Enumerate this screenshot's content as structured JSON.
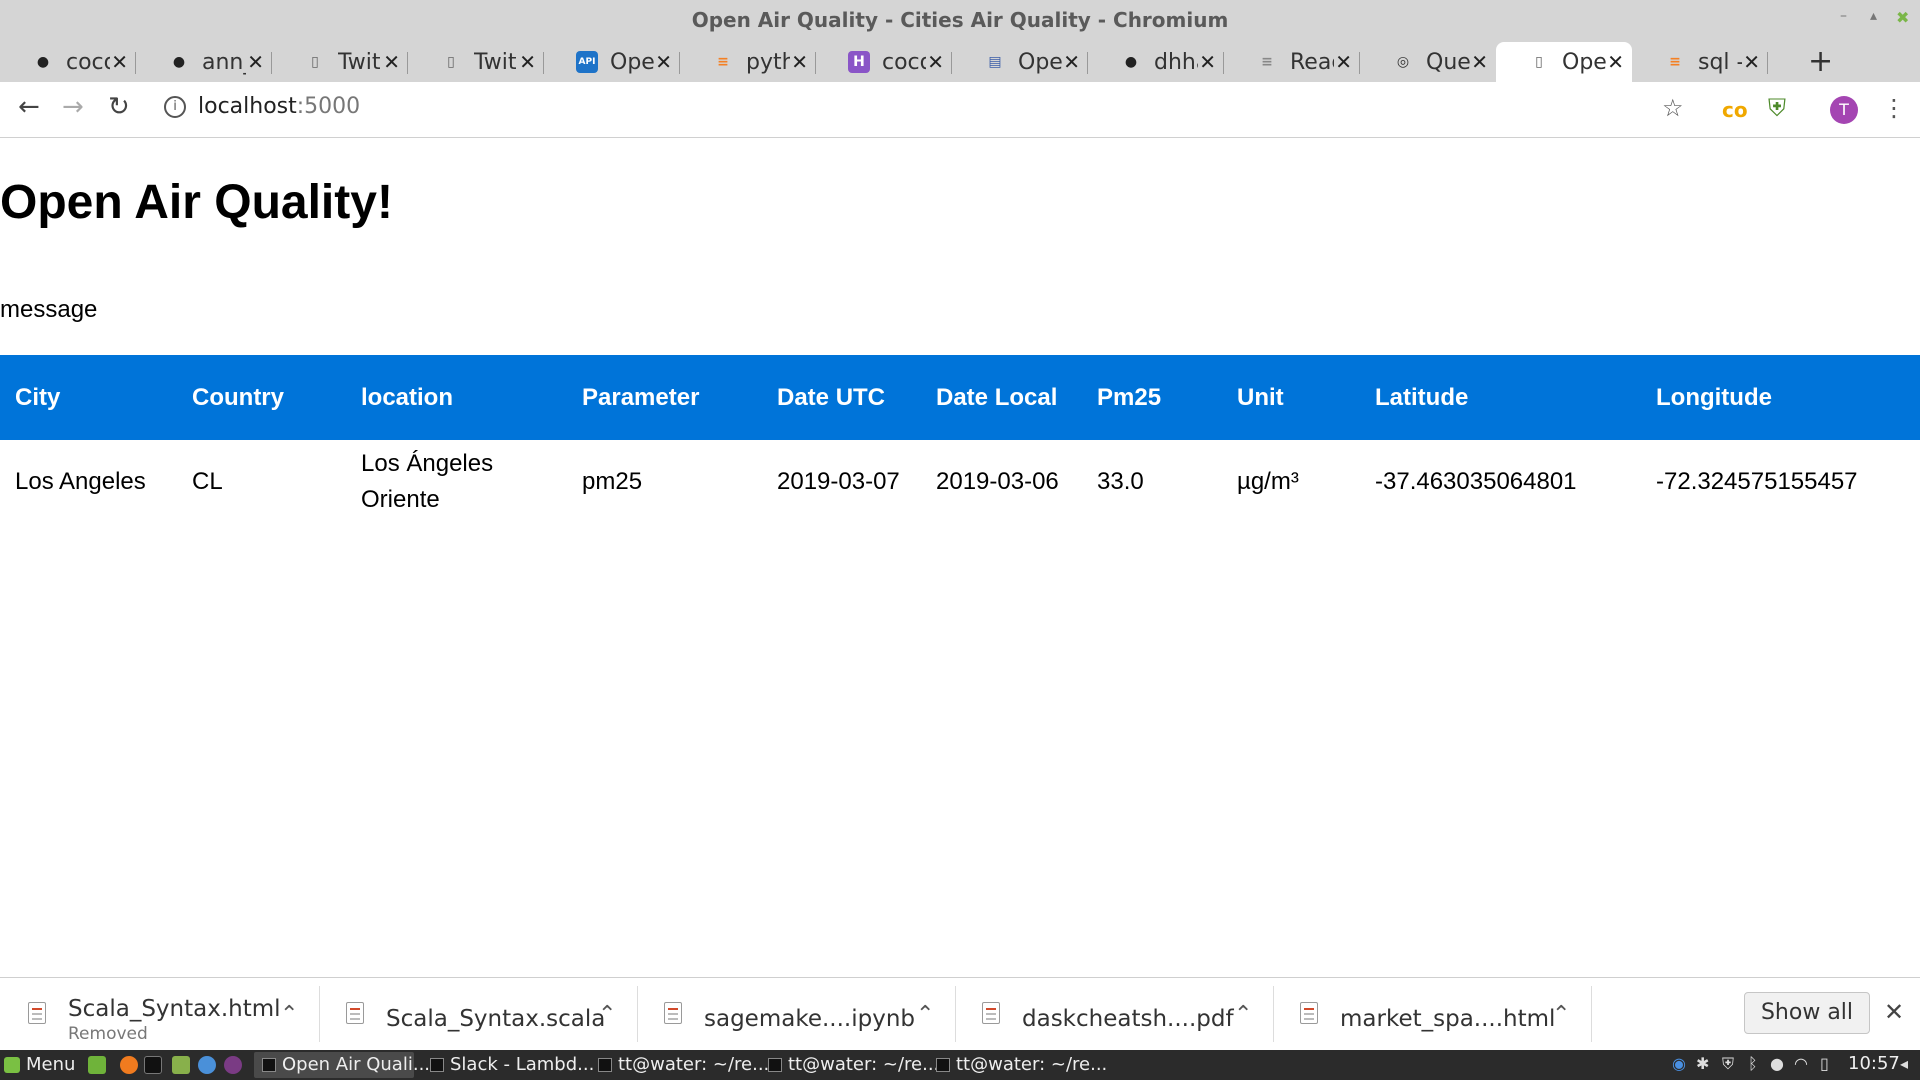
{
  "window": {
    "title": "Open Air Quality - Cities Air Quality - Chromium"
  },
  "tabs": [
    {
      "label": "coco",
      "icon": "github-icon"
    },
    {
      "label": "ann_",
      "icon": "github-icon"
    },
    {
      "label": "Twit",
      "icon": "page-icon"
    },
    {
      "label": "Twit",
      "icon": "page-icon"
    },
    {
      "label": "Oper",
      "icon": "api-icon"
    },
    {
      "label": "pyth",
      "icon": "stackoverflow-icon"
    },
    {
      "label": "coco",
      "icon": "h-icon"
    },
    {
      "label": "Oper",
      "icon": "openaq-icon"
    },
    {
      "label": "dhha",
      "icon": "github-icon"
    },
    {
      "label": "Reac",
      "icon": "docs-icon"
    },
    {
      "label": "Quer",
      "icon": "query-icon"
    },
    {
      "label": "Oper",
      "icon": "page-icon",
      "active": true
    },
    {
      "label": "sql -",
      "icon": "stackoverflow-icon"
    }
  ],
  "address": {
    "host": "localhost",
    "port": ":5000"
  },
  "profile": {
    "initial": "T"
  },
  "page": {
    "heading": "Open Air Quality!",
    "message": "message"
  },
  "table": {
    "headers": [
      "City",
      "Country",
      "location",
      "Parameter",
      "Date UTC",
      "Date Local",
      "Pm25",
      "Unit",
      "Latitude",
      "Longitude"
    ],
    "rows": [
      [
        "Los Angeles",
        "CL",
        "Los Ángeles Oriente",
        "pm25",
        "2019-03-07",
        "2019-03-06",
        "33.0",
        "µg/m³",
        "-37.463035064801",
        "-72.324575155457"
      ]
    ]
  },
  "downloads": [
    {
      "name": "Scala_Syntax.html",
      "status": "Removed"
    },
    {
      "name": "Scala_Syntax.scala",
      "status": ""
    },
    {
      "name": "sagemake....ipynb",
      "status": ""
    },
    {
      "name": "daskcheatsh....pdf",
      "status": ""
    },
    {
      "name": "market_spa....html",
      "status": ""
    }
  ],
  "shelf": {
    "show_all": "Show all"
  },
  "taskbar": {
    "menu": "Menu",
    "tasks": [
      {
        "label": "Open Air Quali...",
        "active": true
      },
      {
        "label": "Slack - Lambd...",
        "active": false
      },
      {
        "label": "tt@water: ~/re...",
        "active": false
      },
      {
        "label": "tt@water: ~/re...",
        "active": false
      },
      {
        "label": "tt@water: ~/re...",
        "active": false
      }
    ],
    "clock": "10:57"
  },
  "colors": {
    "table_header_bg": "#0074d9",
    "chrome_frame": "#d5d5d5",
    "profile_avatar": "#a445b2",
    "taskbar_bg": "#2b2b2b"
  }
}
